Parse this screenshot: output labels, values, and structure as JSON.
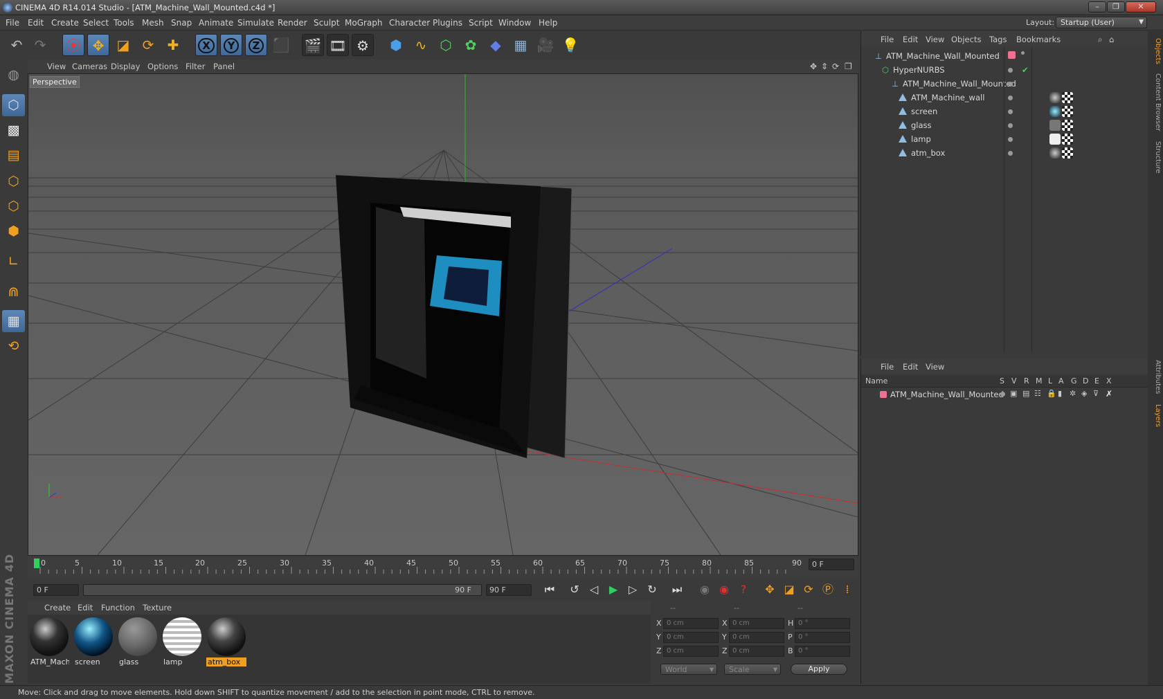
{
  "window": {
    "title": "CINEMA 4D R14.014 Studio - [ATM_Machine_Wall_Mounted.c4d *]"
  },
  "menubar": {
    "items": [
      "File",
      "Edit",
      "Create",
      "Select",
      "Tools",
      "Mesh",
      "Snap",
      "Animate",
      "Simulate",
      "Render",
      "Sculpt",
      "MoGraph",
      "Character",
      "Plugins",
      "Script",
      "Window",
      "Help"
    ],
    "layout_label": "Layout:",
    "layout_value": "Startup (User)"
  },
  "toolbar": {
    "icons": [
      "undo-icon",
      "redo-icon",
      "live-selection-icon",
      "move-icon",
      "scale-icon",
      "rotate-icon",
      "add-icon",
      "x-axis-icon",
      "y-axis-icon",
      "z-axis-icon",
      "coordinate-system-icon",
      "render-view-icon",
      "render-picture-viewer-icon",
      "edit-render-settings-icon",
      "cube-icon",
      "spline-pen-icon",
      "subdivision-icon",
      "cloner-icon",
      "deformer-icon",
      "floor-icon",
      "camera-icon",
      "light-icon"
    ],
    "x": "X",
    "y": "Y",
    "z": "Z"
  },
  "viewport": {
    "menu": [
      "View",
      "Cameras",
      "Display",
      "Options",
      "Filter",
      "Panel"
    ],
    "label": "Perspective"
  },
  "timeline": {
    "ticks": [
      "0",
      "5",
      "10",
      "15",
      "20",
      "25",
      "30",
      "35",
      "40",
      "45",
      "50",
      "55",
      "60",
      "65",
      "70",
      "75",
      "80",
      "85",
      "90"
    ],
    "current": "0 F"
  },
  "transport": {
    "start": "0 F",
    "slider_end": "90 F",
    "end": "90 F"
  },
  "materials": {
    "menu": [
      "Create",
      "Edit",
      "Function",
      "Texture"
    ],
    "items": [
      {
        "label": "ATM_Mach"
      },
      {
        "label": "screen"
      },
      {
        "label": "glass"
      },
      {
        "label": "lamp"
      },
      {
        "label": "atm_box"
      }
    ]
  },
  "coords": {
    "header": [
      "--",
      "--",
      "--"
    ],
    "rows": [
      {
        "a": "X",
        "av": "0 cm",
        "b": "X",
        "bv": "0 cm",
        "c": "H",
        "cv": "0 °"
      },
      {
        "a": "Y",
        "av": "0 cm",
        "b": "Y",
        "bv": "0 cm",
        "c": "P",
        "cv": "0 °"
      },
      {
        "a": "Z",
        "av": "0 cm",
        "b": "Z",
        "bv": "0 cm",
        "c": "B",
        "cv": "0 °"
      }
    ],
    "mode1": "World",
    "mode2": "Scale",
    "apply": "Apply"
  },
  "objects": {
    "menu": [
      "File",
      "Edit",
      "View",
      "Objects",
      "Tags",
      "Bookmarks"
    ],
    "tree": [
      {
        "name": "ATM_Machine_Wall_Mounted",
        "level": 0
      },
      {
        "name": "HyperNURBS",
        "level": 1
      },
      {
        "name": "ATM_Machine_Wall_Mounted",
        "level": 2
      },
      {
        "name": "ATM_Machine_wall",
        "level": 3
      },
      {
        "name": "screen",
        "level": 3
      },
      {
        "name": "glass",
        "level": 3
      },
      {
        "name": "lamp",
        "level": 3
      },
      {
        "name": "atm_box",
        "level": 3
      }
    ]
  },
  "layers": {
    "menu": [
      "File",
      "Edit",
      "View"
    ],
    "columns": [
      "Name",
      "S",
      "V",
      "R",
      "M",
      "L",
      "A",
      "G",
      "D",
      "E",
      "X"
    ],
    "row": "ATM_Machine_Wall_Mounted"
  },
  "righttabs": [
    "Objects",
    "Content Browser",
    "Structure",
    "Attributes",
    "Layers"
  ],
  "status": "Move: Click and drag to move elements. Hold down SHIFT to quantize movement / add to the selection in point mode, CTRL to remove.",
  "branding": {
    "logo_text": "MAXON CINEMA 4D"
  }
}
